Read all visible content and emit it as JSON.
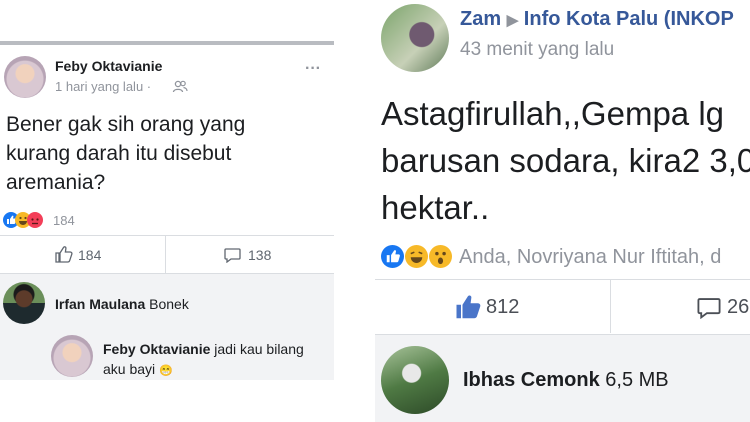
{
  "left_post": {
    "author": "Feby Oktavianie",
    "time": "1 hari yang lalu",
    "time_separator": "·",
    "more_label": "···",
    "text_lines": [
      "Bener gak sih orang yang",
      "kurang darah itu disebut",
      "aremania?"
    ],
    "reaction_count": "184",
    "like_count": "184",
    "comment_count": "138",
    "comments": [
      {
        "author": "Irfan Maulana",
        "text": "Bonek"
      },
      {
        "author": "Feby Oktavianie",
        "text_line1": "jadi kau bilang",
        "text_line2": "aku bayi",
        "emoji": "😁"
      }
    ]
  },
  "right_post": {
    "author": "Zam",
    "arrow": "▶",
    "group": "Info Kota Palu (INKOP",
    "time": "43 menit yang lalu",
    "text_lines": [
      "Astagfirullah,,Gempa lg",
      "barusan sodara, kira2 3,0",
      "hektar.."
    ],
    "reaction_names": "Anda, Novriyana Nur Iftitah, d",
    "like_count": "812",
    "comment_count": "26",
    "comment": {
      "author": "Ibhas Cemonk",
      "text": "6,5 MB"
    }
  },
  "colors": {
    "facebook_blue": "#1877f2",
    "like_blue": "#4a75c9",
    "haha_yellow": "#f7b928",
    "love_red": "#f33e58",
    "muted_gray": "#90949c"
  }
}
